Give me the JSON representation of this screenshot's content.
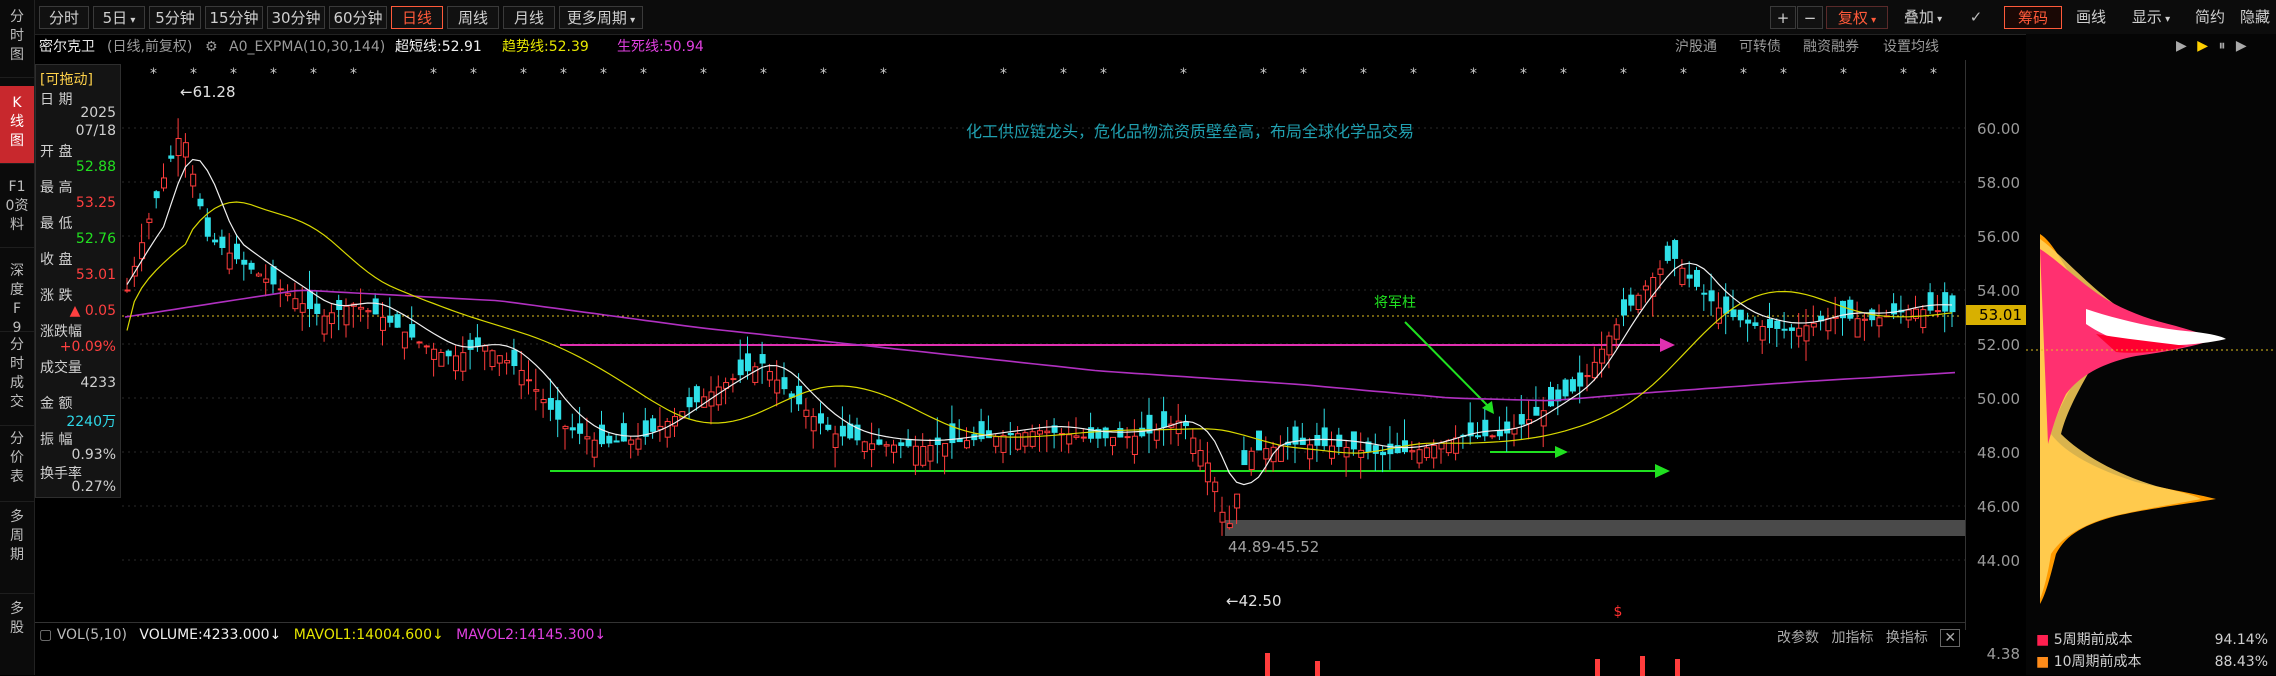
{
  "rail": {
    "tabs": [
      {
        "label": "分时图"
      },
      {
        "label": "K线图"
      },
      {
        "label": "F10资料"
      },
      {
        "label": "深度F9"
      },
      {
        "label": "分时成交"
      },
      {
        "label": "分价表"
      },
      {
        "label": "多周期"
      },
      {
        "label": "多股"
      }
    ]
  },
  "toolbar": {
    "periods": [
      "分时",
      "5日",
      "5分钟",
      "15分钟",
      "30分钟",
      "60分钟",
      "日线",
      "周线",
      "月线",
      "更多周期"
    ],
    "active_period": "日线",
    "right_buttons": [
      "复权",
      "叠加",
      "筹码",
      "画线",
      "显示",
      "简约",
      "隐藏"
    ],
    "plus": "+",
    "minus": "−",
    "check": "✓"
  },
  "indicator": {
    "stock_name": "密尔克卫",
    "mode": "(日线,前复权)",
    "formula": "A0_EXPMA(10,30,144)",
    "short_line": "超短线:52.91",
    "trend_line": "趋势线:52.39",
    "life_line": "生死线:50.94",
    "links": [
      "沪股通",
      "可转债",
      "融资融券",
      "设置均线"
    ]
  },
  "info_panel": {
    "draggable": "[可拖动]",
    "date_label": "日 期",
    "year": "2025",
    "date": "07/18",
    "open_label": "开 盘",
    "open": "52.88",
    "high_label": "最 高",
    "high": "53.25",
    "low_label": "最 低",
    "low": "52.76",
    "close_label": "收 盘",
    "close": "53.01",
    "change_label": "涨 跌",
    "change": "▲ 0.05",
    "pct_label": "涨跌幅",
    "pct": "+0.09%",
    "vol_label": "成交量",
    "vol": "4233",
    "amount_label": "金 额",
    "amount": "2240万",
    "amp_label": "振 幅",
    "amp": "0.93%",
    "turnover_label": "换手率",
    "turnover": "0.27%"
  },
  "chart": {
    "headline": "化工供应链龙头，危化品物流资质壁垒高，布局全球化学品交易",
    "annotation": "将军柱",
    "max_label": "←61.28",
    "min_label": "←42.50",
    "gap_label": "44.89-45.52",
    "current_price": "53.01",
    "price_ticks": [
      "60.00",
      "58.00",
      "56.00",
      "54.00",
      "52.00",
      "50.00",
      "48.00",
      "46.00",
      "44.00"
    ],
    "colors": {
      "up": "#ff3c3c",
      "down": "#2fe0e8",
      "short": "#ffffff",
      "trend": "#e6e600",
      "life": "#d040d0"
    }
  },
  "volume": {
    "label": "VOL(5,10)",
    "volume": "VOLUME:4233.000",
    "mavol1": "MAVOL1:14004.600",
    "mavol2": "MAVOL2:14145.300",
    "links": [
      "改参数",
      "加指标",
      "换指标"
    ],
    "axis_value": "4.38"
  },
  "chip_panel": {
    "legend": [
      {
        "label": "5周期前成本",
        "value": "94.14%",
        "color": "#ff2050"
      },
      {
        "label": "10周期前成本",
        "value": "88.43%",
        "color": "#ff8c1a"
      }
    ]
  }
}
